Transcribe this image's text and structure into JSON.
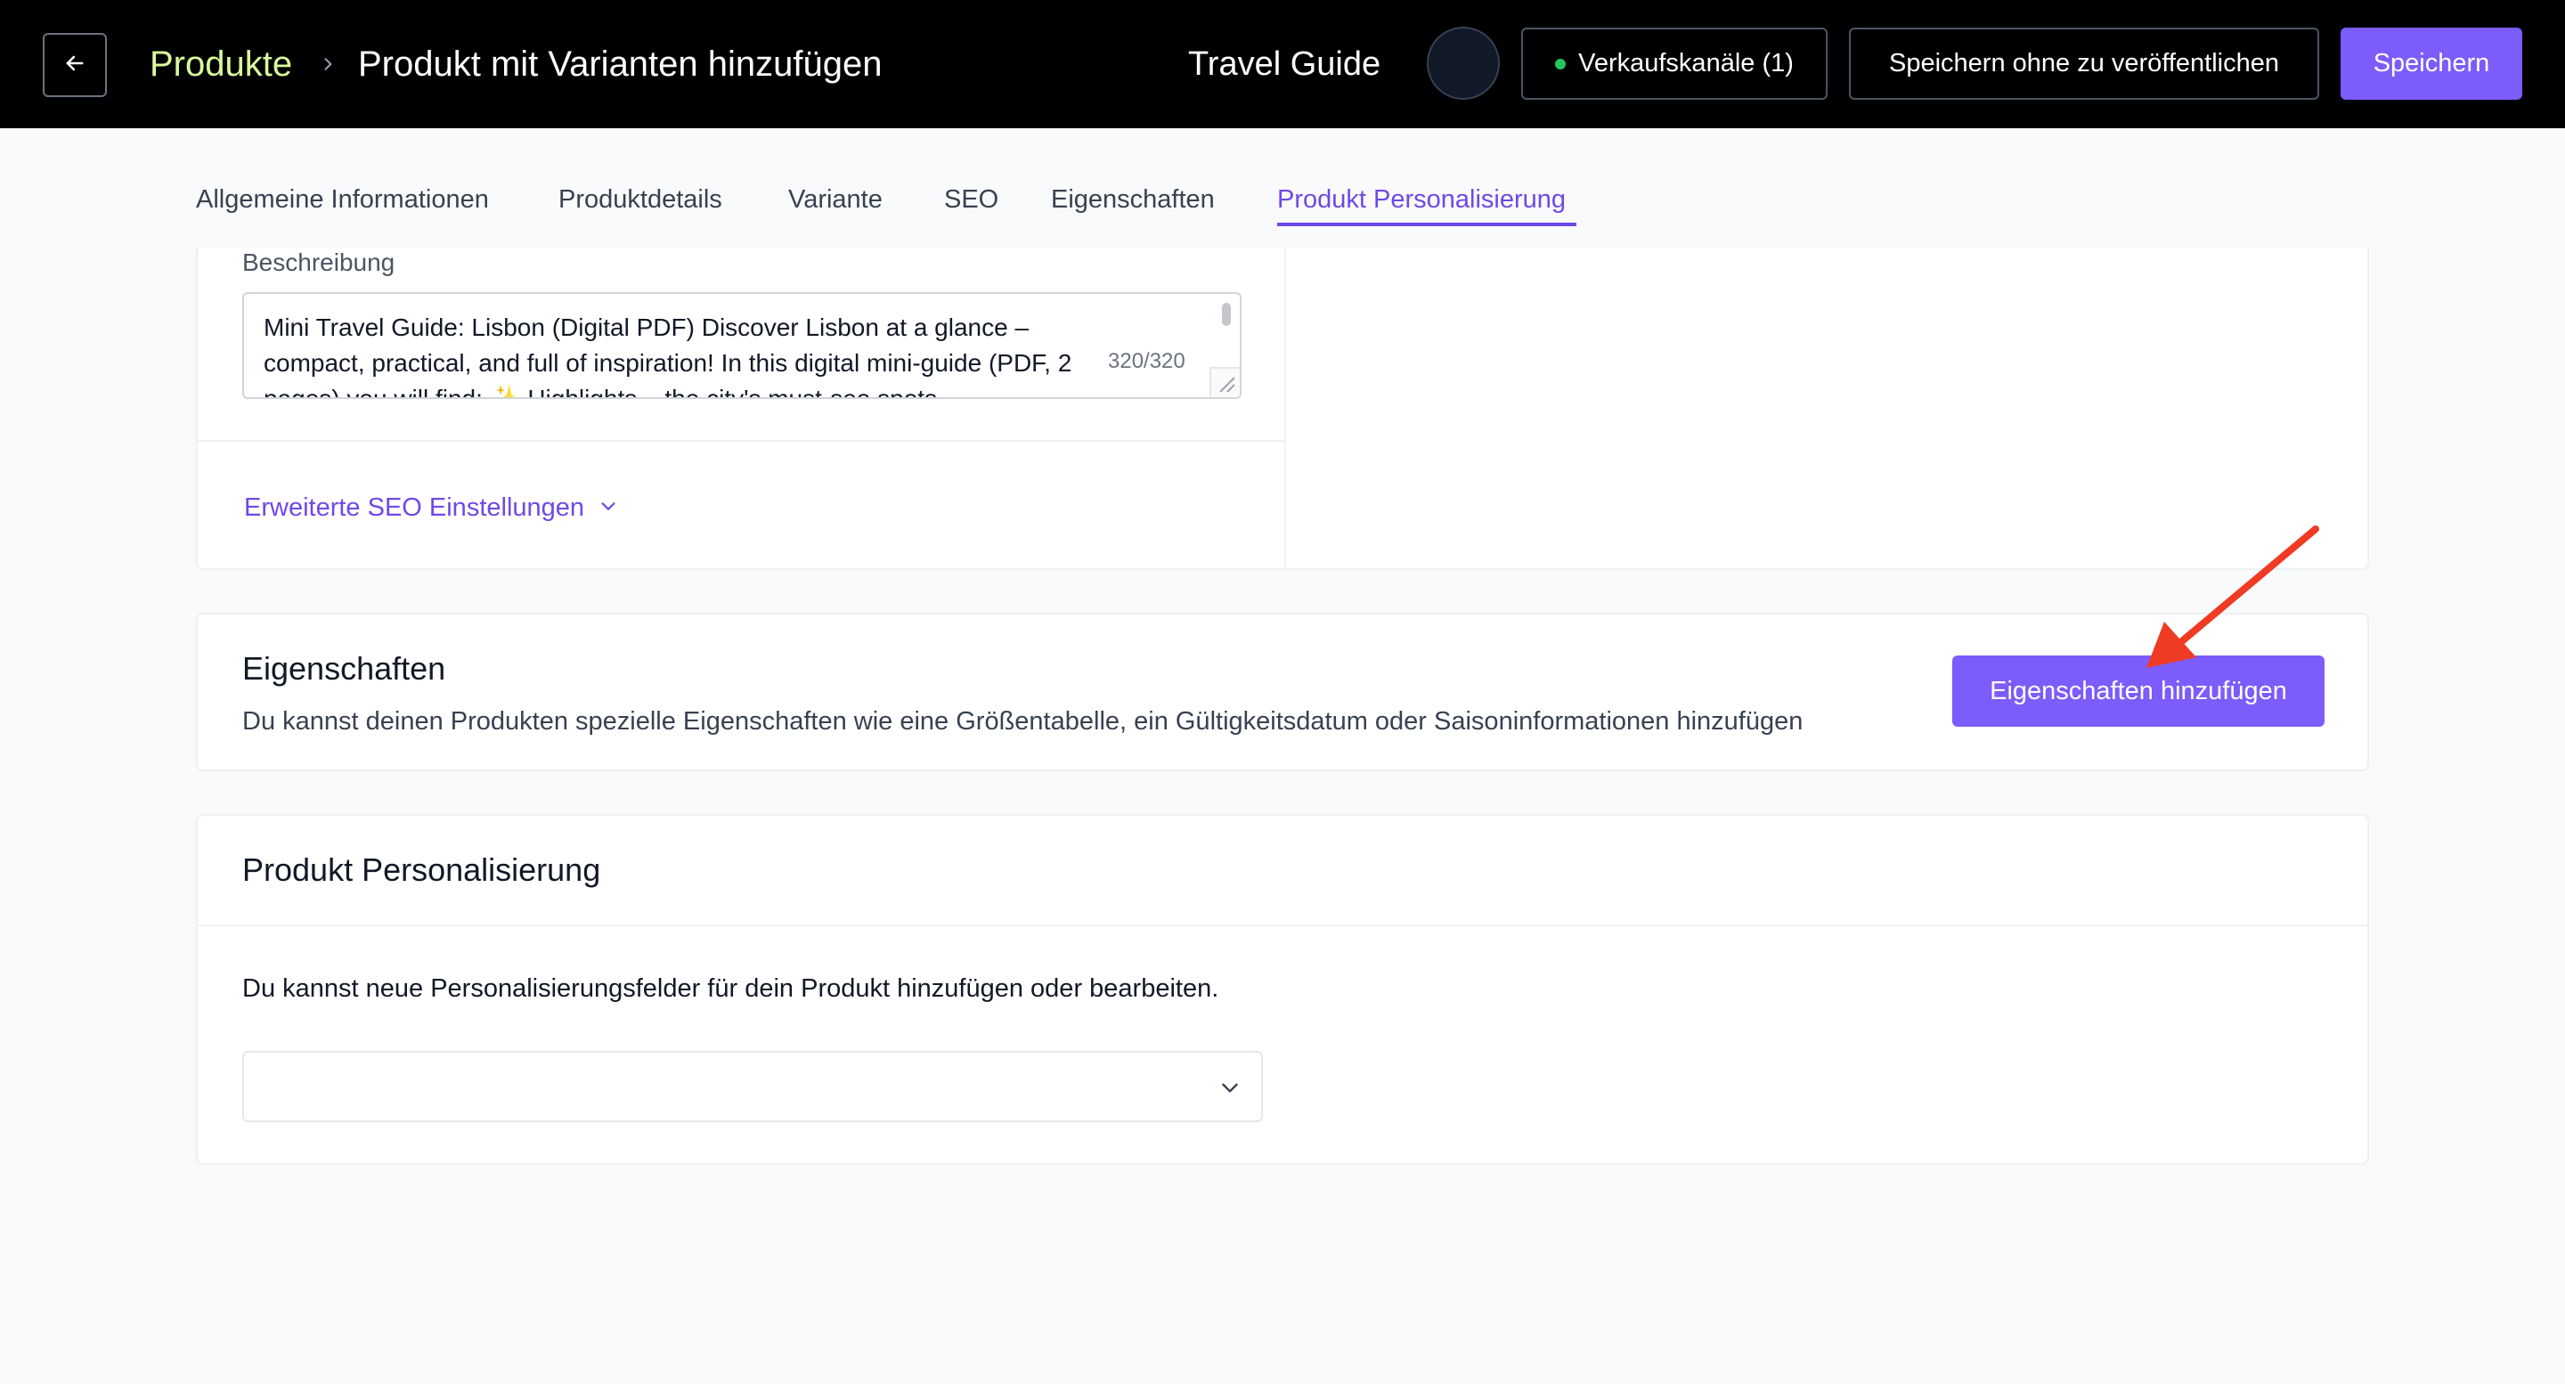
{
  "header": {
    "breadcrumb_root": "Produkte",
    "page_title": "Produkt mit Varianten hinzufügen",
    "shop_name": "Travel Guide",
    "channels_label": "Verkaufskanäle (1)",
    "save_draft_label": "Speichern ohne zu veröffentlichen",
    "save_label": "Speichern"
  },
  "tabs": [
    {
      "label": "Allgemeine Informationen"
    },
    {
      "label": "Produktdetails"
    },
    {
      "label": "Variante"
    },
    {
      "label": "SEO"
    },
    {
      "label": "Eigenschaften"
    },
    {
      "label": "Produkt Personalisierung",
      "active": true
    }
  ],
  "seo": {
    "description_label": "Beschreibung",
    "description_value": "Mini Travel Guide: Lisbon (Digital PDF) Discover Lisbon at a glance – compact, practical, and full of inspiration! In this digital mini-guide (PDF, 2 pages) you will find: ✨ Highlights – the city's must-see spots",
    "char_count": "320/320",
    "advanced_label": "Erweiterte SEO Einstellungen"
  },
  "properties": {
    "title": "Eigenschaften",
    "description": "Du kannst deinen Produkten spezielle Eigenschaften wie eine Größentabelle, ein Gültigkeitsdatum oder Saisoninformationen hinzufügen",
    "add_button_label": "Eigenschaften hinzufügen"
  },
  "personalization": {
    "title": "Produkt Personalisierung",
    "description": "Du kannst neue Personalisierungsfelder für dein Produkt hinzufügen oder bearbeiten.",
    "select_value": ""
  },
  "colors": {
    "accent": "#7c5cfa",
    "accent_text": "#7048e8",
    "breadcrumb_root": "#d9f99d",
    "annotation_arrow": "#ef3b24",
    "status_dot": "#22c55e"
  }
}
